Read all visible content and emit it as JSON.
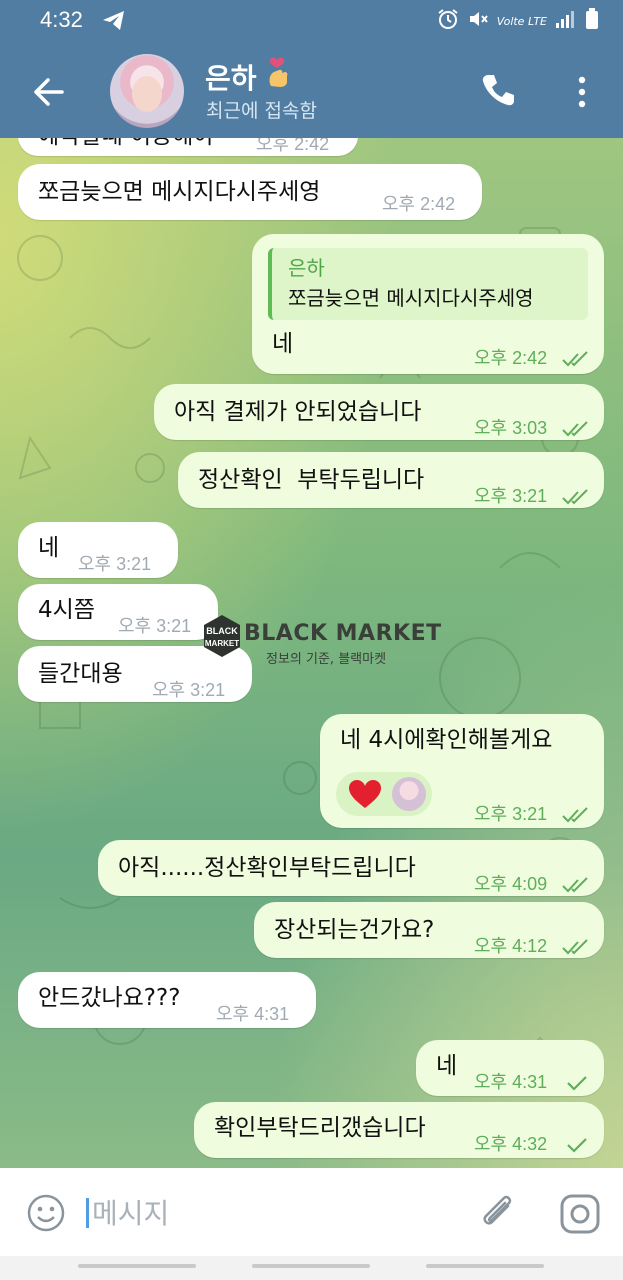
{
  "status_bar": {
    "time": "4:32",
    "network_label": "Volte LTE"
  },
  "header": {
    "contact_name": "은하",
    "status": "최근에 접속함",
    "name_emoji": "finger-heart-icon"
  },
  "messages": [
    {
      "dir": "in",
      "text": "예약할때 이용해야",
      "time": "오후 2:42"
    },
    {
      "dir": "in",
      "text": "쪼금늦으면 메시지다시주세영",
      "time": "오후 2:42"
    },
    {
      "dir": "out",
      "reply_name": "은하",
      "reply_text": "쪼금늦으면 메시지다시주세영",
      "text": "네",
      "time": "오후 2:42",
      "status": "read"
    },
    {
      "dir": "out",
      "text": "아직 결제가 안되었습니다",
      "time": "오후 3:03",
      "status": "read"
    },
    {
      "dir": "out",
      "text": "정산확인  부탁두립니다",
      "time": "오후 3:21",
      "status": "read"
    },
    {
      "dir": "in",
      "text": "네",
      "time": "오후 3:21"
    },
    {
      "dir": "in",
      "text": "4시쯤",
      "time": "오후 3:21"
    },
    {
      "dir": "in",
      "text": "들간대용",
      "time": "오후 3:21"
    },
    {
      "dir": "out",
      "text": "네 4시에확인해볼게요",
      "time": "오후 3:21",
      "status": "read",
      "reactions": [
        "heart"
      ]
    },
    {
      "dir": "out",
      "text": "아직......정산확인부탁드립니다",
      "time": "오후 4:09",
      "status": "read"
    },
    {
      "dir": "out",
      "text": "장산되는건가요?",
      "time": "오후 4:12",
      "status": "read"
    },
    {
      "dir": "in",
      "text": "안드갔나요???",
      "time": "오후 4:31"
    },
    {
      "dir": "out",
      "text": "네",
      "time": "오후 4:31",
      "status": "sent"
    },
    {
      "dir": "out",
      "text": "확인부탁드리갰습니다",
      "time": "오후 4:32",
      "status": "sent"
    }
  ],
  "watermark": {
    "badge_top": "BLACK",
    "badge_bottom": "MARKET",
    "title": "BLACK MARKET",
    "subtitle": "정보의 기준, 블랙마켓"
  },
  "composer": {
    "placeholder": "메시지"
  },
  "colors": {
    "header": "#517da2",
    "outgoing_bubble": "#effdde",
    "incoming_bubble": "#ffffff",
    "outgoing_time": "#5eae5b"
  }
}
